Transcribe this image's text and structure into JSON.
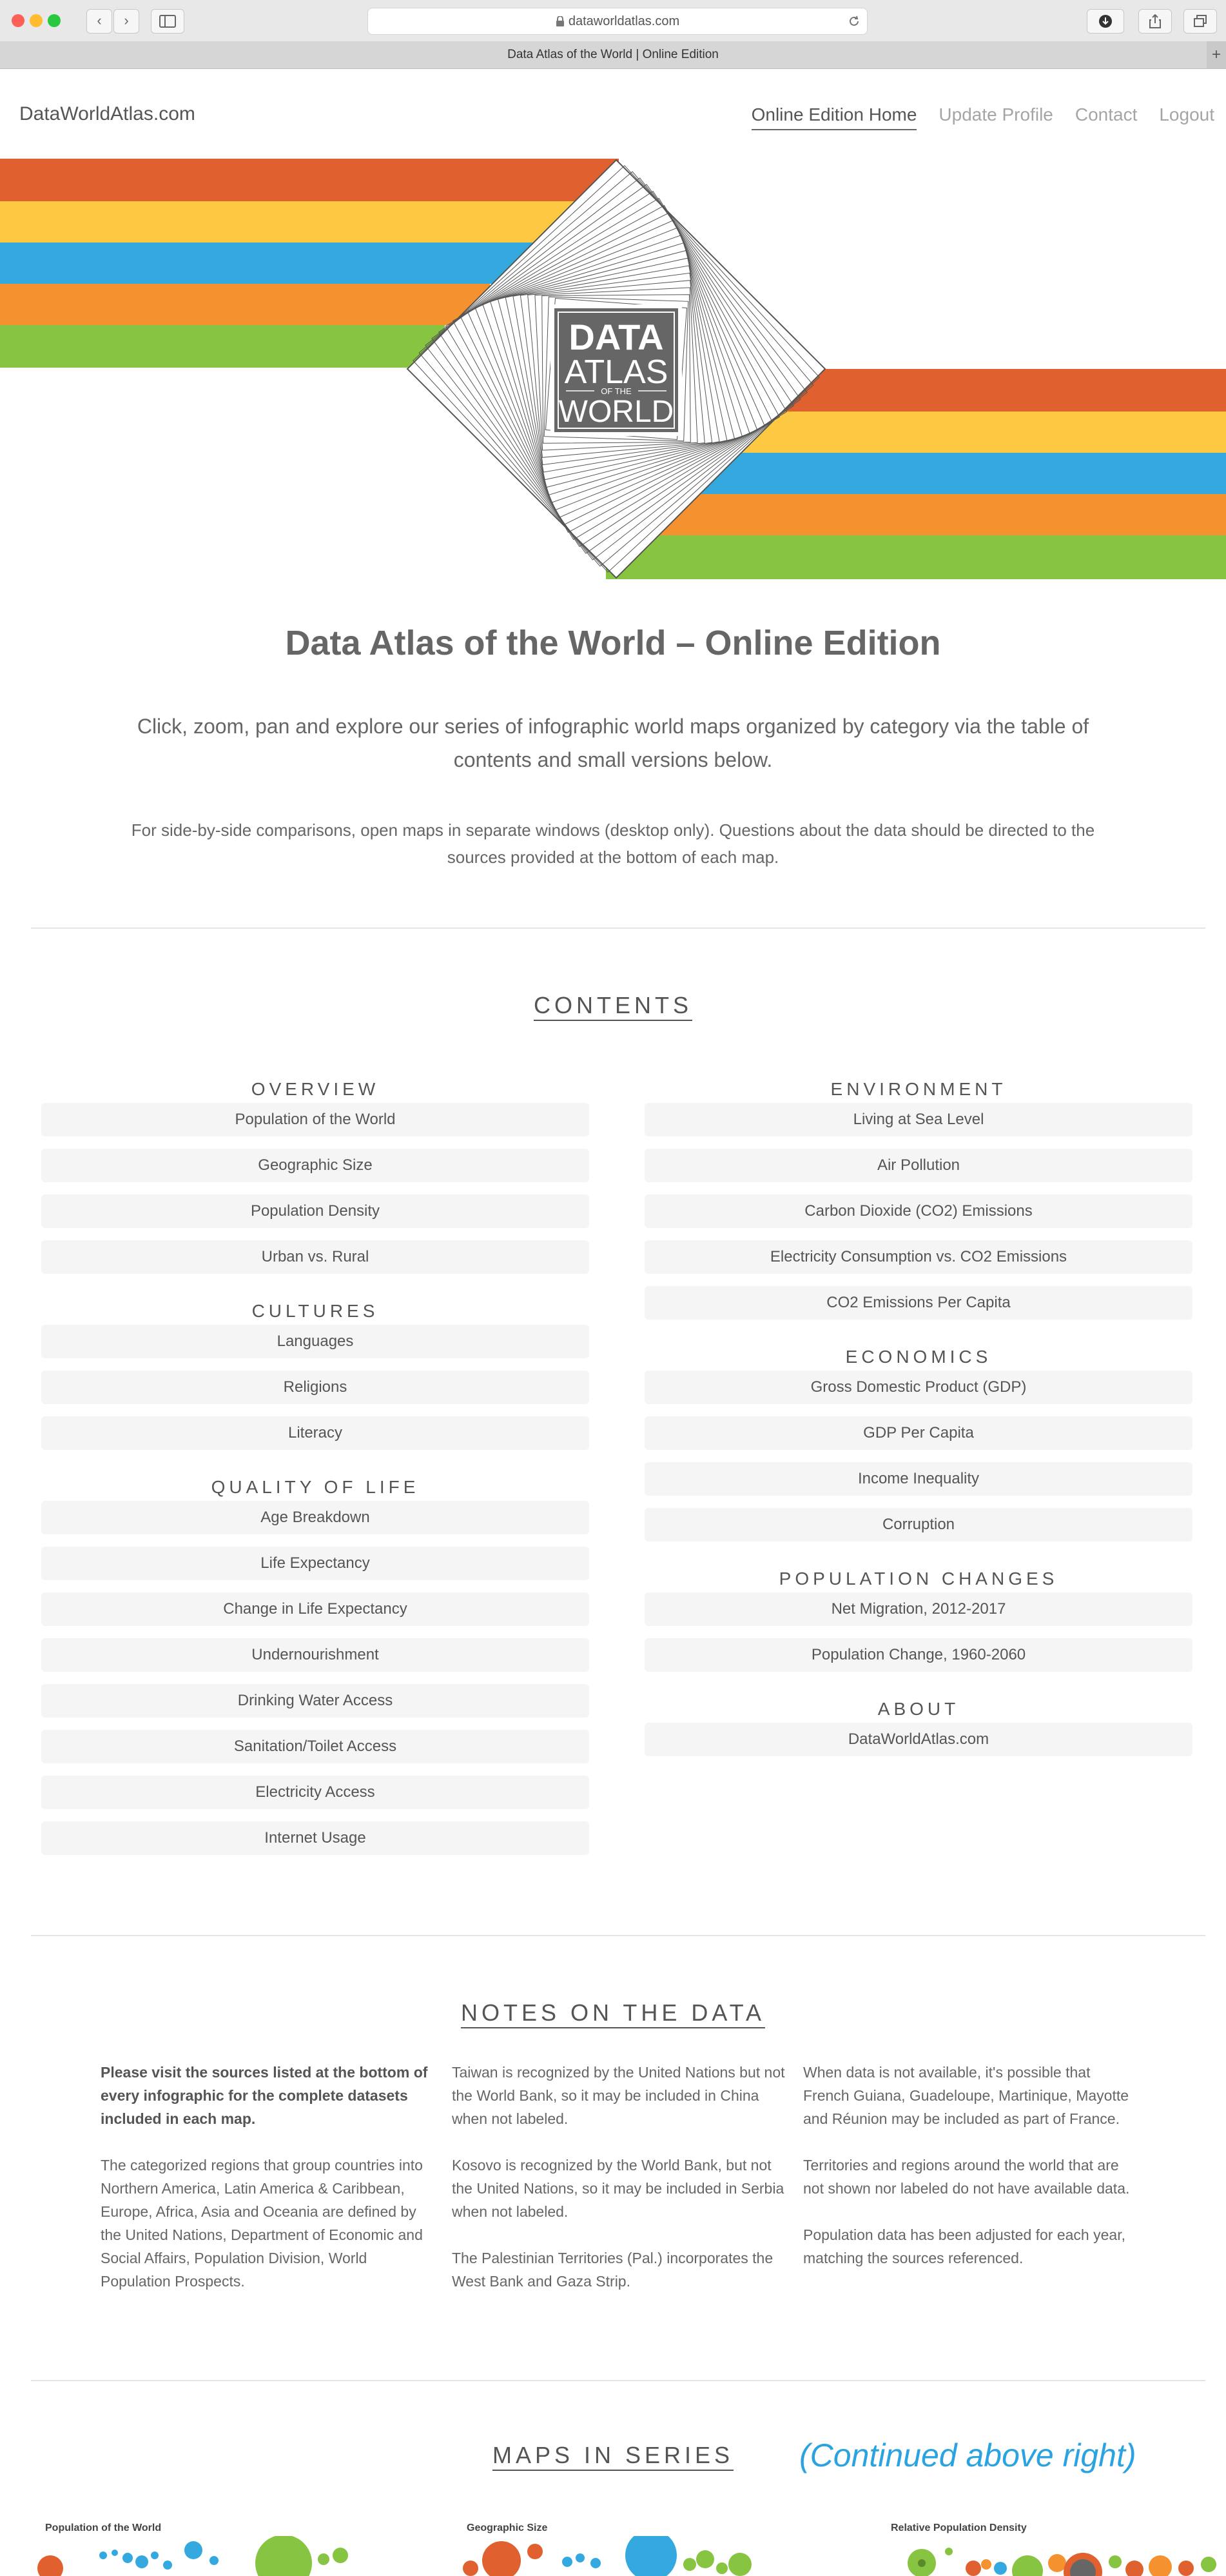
{
  "browser": {
    "url": "dataworldatlas.com",
    "tab_title": "Data Atlas of the World | Online Edition",
    "back_glyph": "‹",
    "forward_glyph": "›",
    "plus_glyph": "+"
  },
  "header": {
    "brand": "DataWorldAtlas.com",
    "nav": [
      "Online Edition Home",
      "Update Profile",
      "Contact",
      "Logout"
    ]
  },
  "hero": {
    "logo_line1": "DATA",
    "logo_line2": "ATLAS",
    "logo_line3": "OF THE",
    "logo_line4": "WORLD",
    "stripe_colors": [
      "#e0612f",
      "#fdc842",
      "#33a9df",
      "#f4922f",
      "#86c441"
    ]
  },
  "page": {
    "title": "Data Atlas of the World – Online Edition",
    "intro": "Click, zoom, pan and explore our series of infographic world maps organized by category via the table of contents and small versions below.",
    "intro2": "For side-by-side comparisons, open maps in separate windows (desktop only). Questions about the data should be directed to the sources provided at the bottom of each map."
  },
  "contents": {
    "title": "CONTENTS",
    "overview": {
      "heading": "OVERVIEW",
      "items": [
        "Population of the World",
        "Geographic Size",
        "Population Density",
        "Urban vs. Rural"
      ]
    },
    "cultures": {
      "heading": "CULTURES",
      "items": [
        "Languages",
        "Religions",
        "Literacy"
      ]
    },
    "quality": {
      "heading": "QUALITY OF LIFE",
      "items": [
        "Age Breakdown",
        "Life Expectancy",
        "Change in Life Expectancy",
        "Undernourishment",
        "Drinking Water Access",
        "Sanitation/Toilet Access",
        "Electricity Access",
        "Internet Usage"
      ]
    },
    "environment": {
      "heading": "ENVIRONMENT",
      "items": [
        "Living at Sea Level",
        "Air Pollution",
        "Carbon Dioxide (CO2) Emissions",
        "Electricity Consumption vs. CO2 Emissions",
        "CO2 Emissions Per Capita"
      ]
    },
    "economics": {
      "heading": "ECONOMICS",
      "items": [
        "Gross Domestic Product (GDP)",
        "GDP Per Capita",
        "Income Inequality",
        "Corruption"
      ]
    },
    "population": {
      "heading": "POPULATION CHANGES",
      "items": [
        "Net Migration, 2012-2017",
        "Population Change, 1960-2060"
      ]
    },
    "about": {
      "heading": "ABOUT",
      "items": [
        "DataWorldAtlas.com"
      ]
    }
  },
  "notes": {
    "title": "NOTES ON THE DATA",
    "col1_p1": "Please visit the sources listed at the bottom of every infographic for the complete datasets included in each map.",
    "col1_p2": "The categorized regions that group countries into Northern America, Latin America & Caribbean, Europe, Africa, Asia and Oceania are defined by the United Nations, Department of Economic and Social Affairs, Population Division, World Population Prospects.",
    "col2_p1": "Taiwan is recognized by the United Nations but not the World Bank, so it may be included in China when not labeled.",
    "col2_p2": "Kosovo is recognized by the World Bank, but not the United Nations, so it may be included in Serbia when not labeled.",
    "col2_p3": "The Palestinian Territories (Pal.) incorporates the West Bank and Gaza Strip.",
    "col3_p1": "When data is not available, it's possible that French Guiana, Guadeloupe, Martinique, Mayotte and Réunion may be included as part of France.",
    "col3_p2": "Territories and regions around the world that are not shown nor labeled do not have available data.",
    "col3_p3": "Population data has been adjusted for each year, matching the sources referenced."
  },
  "series": {
    "title": "MAPS IN SERIES",
    "continued": "(Continued above right)",
    "thumb1": "Population of the World",
    "thumb2": "Geographic Size",
    "thumb3": "Relative Population Density"
  }
}
